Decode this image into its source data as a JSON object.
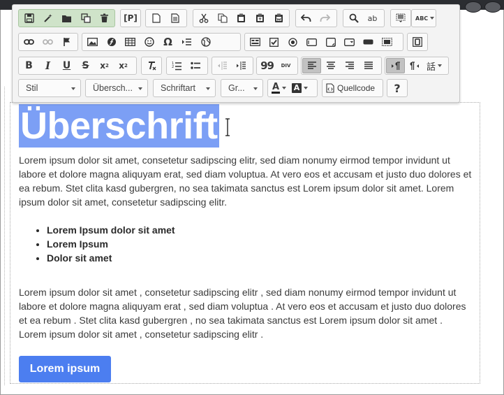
{
  "editor": {
    "heading": "Überschrift",
    "paragraph1": "Lorem ipsum dolor sit amet, consetetur sadipscing elitr, sed diam nonumy eirmod tempor invidunt ut labore et dolore magna aliquyam erat, sed diam voluptua. At vero eos et accusam et justo duo dolores et ea rebum. Stet clita kasd gubergren, no sea takimata sanctus est Lorem ipsum dolor sit amet. Lorem ipsum dolor sit amet, consetetur sadipscing elitr.",
    "bullets": [
      "Lorem Ipsum dolor sit amet",
      "Lorem Ipsum",
      "Dolor sit amet"
    ],
    "paragraph2": "Lorem ipsum dolor sit amet , consetetur sadipscing elitr , sed diam nonumy eirmod tempor invidunt ut labore et dolore magna aliquyam erat , sed diam voluptua . At vero eos et accusam et justo duo dolores et ea rebum . Stet clita kasd gubergren , no sea takimata sanctus est Lorem ipsum dolor sit amet . Lorem ipsum dolor sit amet , consetetur sadipscing elitr .",
    "button_label": "Lorem ipsum"
  },
  "toolbar": {
    "placeholder_label": "[P]",
    "blockquote_glyph": "99",
    "div_glyph": "DIV",
    "style_combo": "Stil",
    "format_combo": "Übersch...",
    "font_combo": "Schriftart",
    "size_combo": "Gr...",
    "text_color_glyph": "A",
    "bg_color_glyph": "A",
    "source_label": "Quellcode",
    "help_label": "?",
    "omega_glyph": "Ω",
    "language_glyph": "話",
    "spell_glyph": "ABC",
    "replace_glyph": "ab"
  },
  "colors": {
    "accent": "#4c7ef0",
    "selection": "#7c9ff5",
    "toolbar_bg": "#f3f3f3",
    "green_group": "#cfe3c9"
  }
}
